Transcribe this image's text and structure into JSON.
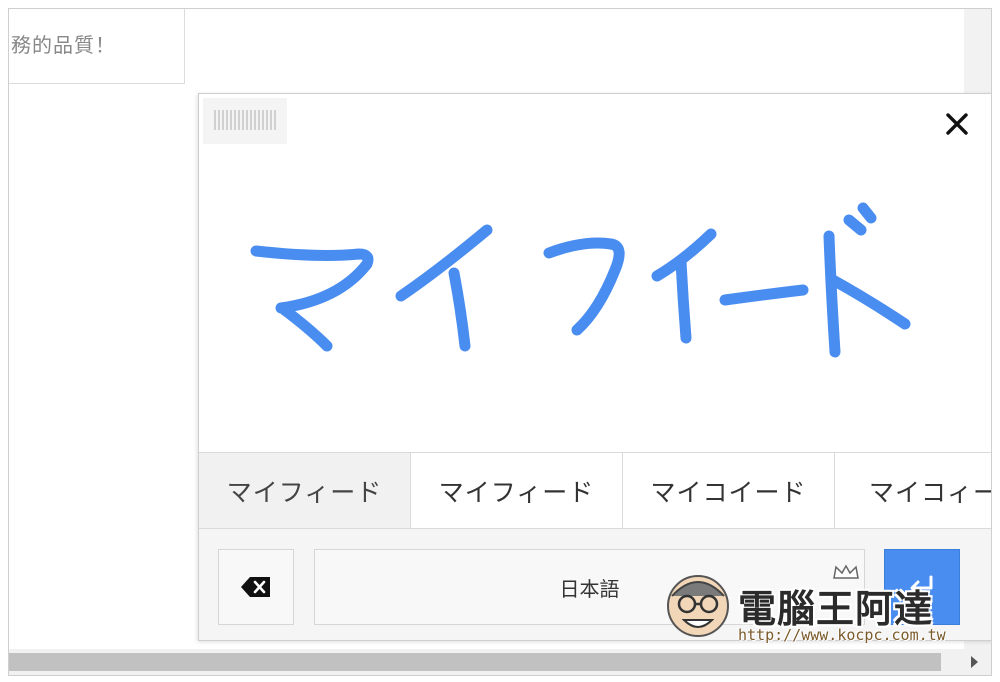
{
  "background": {
    "card_text": "務的品質！"
  },
  "handwriting_panel": {
    "strokes_text": "マイフィード",
    "stroke_color": "#4a8df1",
    "suggestions": [
      {
        "label": "マイフィード",
        "active": true
      },
      {
        "label": "マイフィード",
        "active": false
      },
      {
        "label": "マイコイード",
        "active": false
      },
      {
        "label": "マイコィー",
        "active": false
      }
    ],
    "language_label": "日本語",
    "close_icon": "close-icon",
    "backspace_icon": "backspace-icon",
    "enter_icon": "enter-icon",
    "accent_color": "#4a8df1"
  },
  "watermark": {
    "title": "電腦王阿達",
    "url": "http://www.kocpc.com.tw"
  }
}
